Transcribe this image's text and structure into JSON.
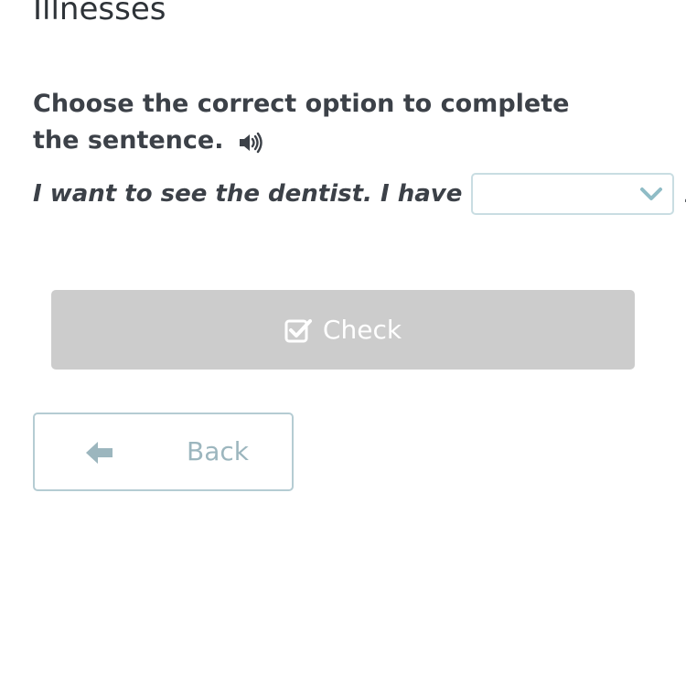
{
  "page": {
    "title": "Illnesses"
  },
  "exercise": {
    "instruction": "Choose the correct option to complete the sentence.",
    "audio_icon": "speaker-icon",
    "sentence_before": "I want to see the dentist. I have",
    "selected_value": "",
    "sentence_after": "."
  },
  "actions": {
    "check_label": "Check",
    "check_icon": "checkbox-check-icon",
    "back_label": "Back",
    "back_icon": "arrow-left-icon"
  },
  "colors": {
    "check_button_bg": "#cccccc",
    "back_text": "#9cb6be",
    "select_border": "#c9dde2",
    "chevron": "#8fbcc6"
  }
}
